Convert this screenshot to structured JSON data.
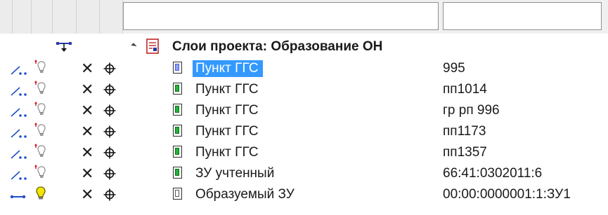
{
  "filters": {
    "name_filter_value": "",
    "value_filter_value": ""
  },
  "tree": {
    "root": {
      "label": "Слои проекта: Образование ОН",
      "icon": "layer-group-icon",
      "expanded": true
    },
    "rows": [
      {
        "label": "Пункт ГГС",
        "value": "995",
        "selected": true,
        "icon": "layer-icon",
        "state": "point-inactive"
      },
      {
        "label": "Пункт ГГС",
        "value": "пп1014",
        "selected": false,
        "icon": "layer-icon",
        "state": "point-inactive"
      },
      {
        "label": "Пункт ГГС",
        "value": "гр рп 996",
        "selected": false,
        "icon": "layer-icon",
        "state": "point-inactive"
      },
      {
        "label": "Пункт ГГС",
        "value": "пп1173",
        "selected": false,
        "icon": "layer-icon",
        "state": "point-inactive"
      },
      {
        "label": "Пункт ГГС",
        "value": "пп1357",
        "selected": false,
        "icon": "layer-icon",
        "state": "point-inactive"
      },
      {
        "label": "ЗУ учтенный",
        "value": "66:41:0302011:6",
        "selected": false,
        "icon": "layer-icon",
        "state": "point-inactive"
      },
      {
        "label": "Образуемый ЗУ",
        "value": "00:00:0000001:1:ЗУ1",
        "selected": false,
        "icon": "layer-icon",
        "state": "line-active"
      }
    ]
  },
  "colors": {
    "selection": "#3399ff",
    "layer_green": "#22b33a",
    "bulb_on": "#f2e600",
    "edit_blue": "#2050c8"
  }
}
